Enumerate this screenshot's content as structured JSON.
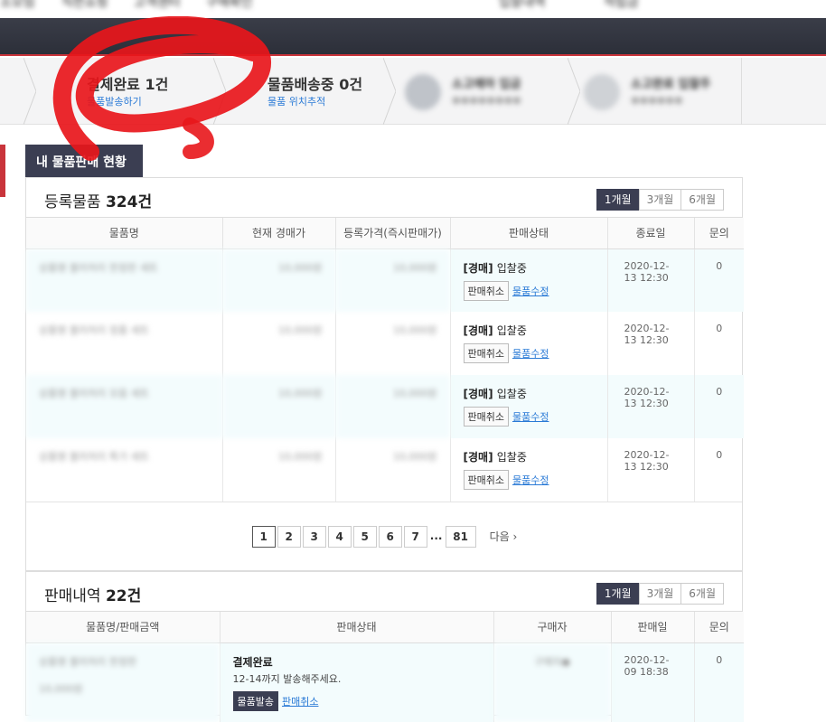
{
  "topnav": [
    "소모임",
    "직판쇼핑",
    "고객센터",
    "구매확인",
    "입찰내역",
    "적립금"
  ],
  "steps": [
    {
      "title": "결제완료",
      "count": "1건",
      "sub": "물품발송하기"
    },
    {
      "title": "물품배송중",
      "count": "0건",
      "sub": "물품 위치추적"
    },
    {
      "title": "소고예마 입금",
      "count": "",
      "sub": "●●●●●●●●"
    },
    {
      "title": "소고완료 입찰주",
      "count": "",
      "sub": "●●●●●●"
    }
  ],
  "my_tab": "내 물품판매 현황",
  "registered": {
    "title": "등록물품",
    "count": "324건",
    "periods": [
      "1개월",
      "3개월",
      "6개월"
    ],
    "columns": [
      "물품명",
      "현재 경매가",
      "등록가격(즉시판매가)",
      "판매상태",
      "종료일",
      "문의"
    ],
    "rows": [
      {
        "name": "상품명 블러처리 한정판 세트",
        "cur": "10,000원",
        "reg": "10,000원",
        "state_tag": "[경매]",
        "state": "입찰중",
        "cancel": "판매취소",
        "edit": "물품수정",
        "end": "2020-12-13 12:30",
        "q": "0"
      },
      {
        "name": "상품명 블러처리 정품 세트",
        "cur": "10,000원",
        "reg": "10,000원",
        "state_tag": "[경매]",
        "state": "입찰중",
        "cancel": "판매취소",
        "edit": "물품수정",
        "end": "2020-12-13 12:30",
        "q": "0"
      },
      {
        "name": "상품명 블러처리 모음 세트",
        "cur": "10,000원",
        "reg": "10,000원",
        "state_tag": "[경매]",
        "state": "입찰중",
        "cancel": "판매취소",
        "edit": "물품수정",
        "end": "2020-12-13 12:30",
        "q": "0"
      },
      {
        "name": "상품명 블러처리 특가 세트",
        "cur": "10,000원",
        "reg": "10,000원",
        "state_tag": "[경매]",
        "state": "입찰중",
        "cancel": "판매취소",
        "edit": "물품수정",
        "end": "2020-12-13 12:30",
        "q": "0"
      }
    ],
    "pages": [
      "1",
      "2",
      "3",
      "4",
      "5",
      "6",
      "7",
      "...",
      "81"
    ],
    "next": "다음"
  },
  "sales": {
    "title": "판매내역",
    "count": "22건",
    "periods": [
      "1개월",
      "3개월",
      "6개월"
    ],
    "columns": [
      "물품명/판매금액",
      "판매상태",
      "구매자",
      "판매일",
      "문의"
    ],
    "row": {
      "name": "상품명 블러처리 한정판",
      "price": "10,000원",
      "state": "결제완료",
      "note": "12-14까지 발송해주세요.",
      "ship": "물품발송",
      "cancel": "판매취소",
      "buyer": "구매자●",
      "date": "2020-12-09 18:38",
      "q": "0"
    }
  },
  "colors": {
    "dark": "#3b3e52",
    "accent_red": "#c9343b",
    "link": "#2a7ad6",
    "row_alt": "#f3fcfd"
  }
}
